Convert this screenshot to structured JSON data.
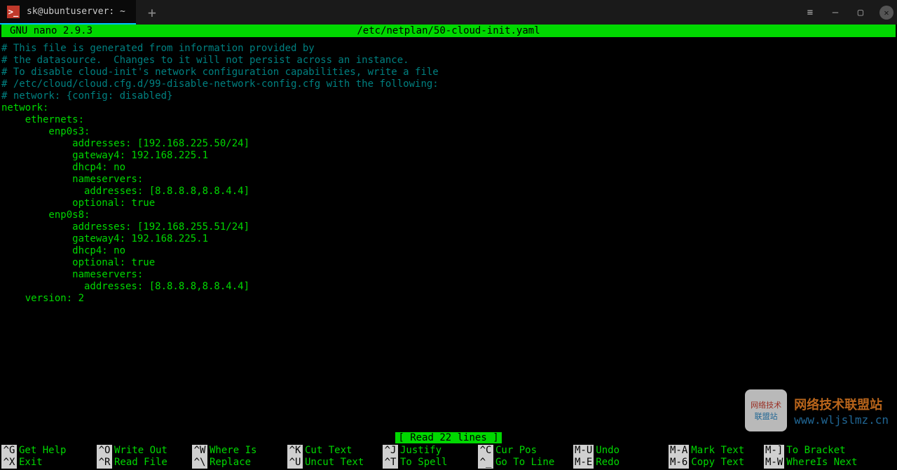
{
  "titlebar": {
    "tab_title": "sk@ubuntuserver: ~",
    "plus": "+",
    "menu": "≡",
    "minimize": "—",
    "maximize": "▢",
    "close": "✕"
  },
  "header": {
    "app": "GNU nano 2.9.3",
    "file": "/etc/netplan/50-cloud-init.yaml"
  },
  "content": [
    {
      "type": "comment",
      "text": "# This file is generated from information provided by"
    },
    {
      "type": "comment",
      "text": "# the datasource.  Changes to it will not persist across an instance."
    },
    {
      "type": "comment",
      "text": "# To disable cloud-init's network configuration capabilities, write a file"
    },
    {
      "type": "comment",
      "text": "# /etc/cloud/cloud.cfg.d/99-disable-network-config.cfg with the following:"
    },
    {
      "type": "comment",
      "text": "# network: {config: disabled}"
    },
    {
      "type": "code",
      "text": "network:"
    },
    {
      "type": "code",
      "text": "    ethernets:"
    },
    {
      "type": "code",
      "text": "        enp0s3:"
    },
    {
      "type": "code",
      "text": "            addresses: [192.168.225.50/24]"
    },
    {
      "type": "code",
      "text": "            gateway4: 192.168.225.1"
    },
    {
      "type": "code",
      "text": "            dhcp4: no"
    },
    {
      "type": "code",
      "text": "            nameservers:"
    },
    {
      "type": "code",
      "text": "              addresses: [8.8.8.8,8.8.4.4]"
    },
    {
      "type": "code",
      "text": "            optional: true"
    },
    {
      "type": "code",
      "text": "        enp0s8:"
    },
    {
      "type": "code",
      "text": "            addresses: [192.168.255.51/24]"
    },
    {
      "type": "code",
      "text": "            gateway4: 192.168.225.1"
    },
    {
      "type": "code",
      "text": "            dhcp4: no"
    },
    {
      "type": "code",
      "text": "            optional: true"
    },
    {
      "type": "code",
      "text": "            nameservers:"
    },
    {
      "type": "code",
      "text": "              addresses: [8.8.8.8,8.8.4.4]"
    },
    {
      "type": "code",
      "text": "    version: 2"
    }
  ],
  "status": "[ Read 22 lines ]",
  "shortcuts": {
    "row1": [
      {
        "key": "^G",
        "desc": "Get Help"
      },
      {
        "key": "^O",
        "desc": "Write Out"
      },
      {
        "key": "^W",
        "desc": "Where Is"
      },
      {
        "key": "^K",
        "desc": "Cut Text"
      },
      {
        "key": "^J",
        "desc": "Justify"
      },
      {
        "key": "^C",
        "desc": "Cur Pos"
      },
      {
        "key": "M-U",
        "desc": "Undo"
      },
      {
        "key": "M-A",
        "desc": "Mark Text"
      },
      {
        "key": "M-]",
        "desc": "To Bracket"
      }
    ],
    "row2": [
      {
        "key": "^X",
        "desc": "Exit"
      },
      {
        "key": "^R",
        "desc": "Read File"
      },
      {
        "key": "^\\",
        "desc": "Replace"
      },
      {
        "key": "^U",
        "desc": "Uncut Text"
      },
      {
        "key": "^T",
        "desc": "To Spell"
      },
      {
        "key": "^_",
        "desc": "Go To Line"
      },
      {
        "key": "M-E",
        "desc": "Redo"
      },
      {
        "key": "M-6",
        "desc": "Copy Text"
      },
      {
        "key": "M-W",
        "desc": "WhereIs Next"
      }
    ]
  },
  "watermark": {
    "box_line1": "网络技术",
    "box_line2": "联盟站",
    "title": "网络技术联盟站",
    "url": "www.wljslmz.cn"
  }
}
